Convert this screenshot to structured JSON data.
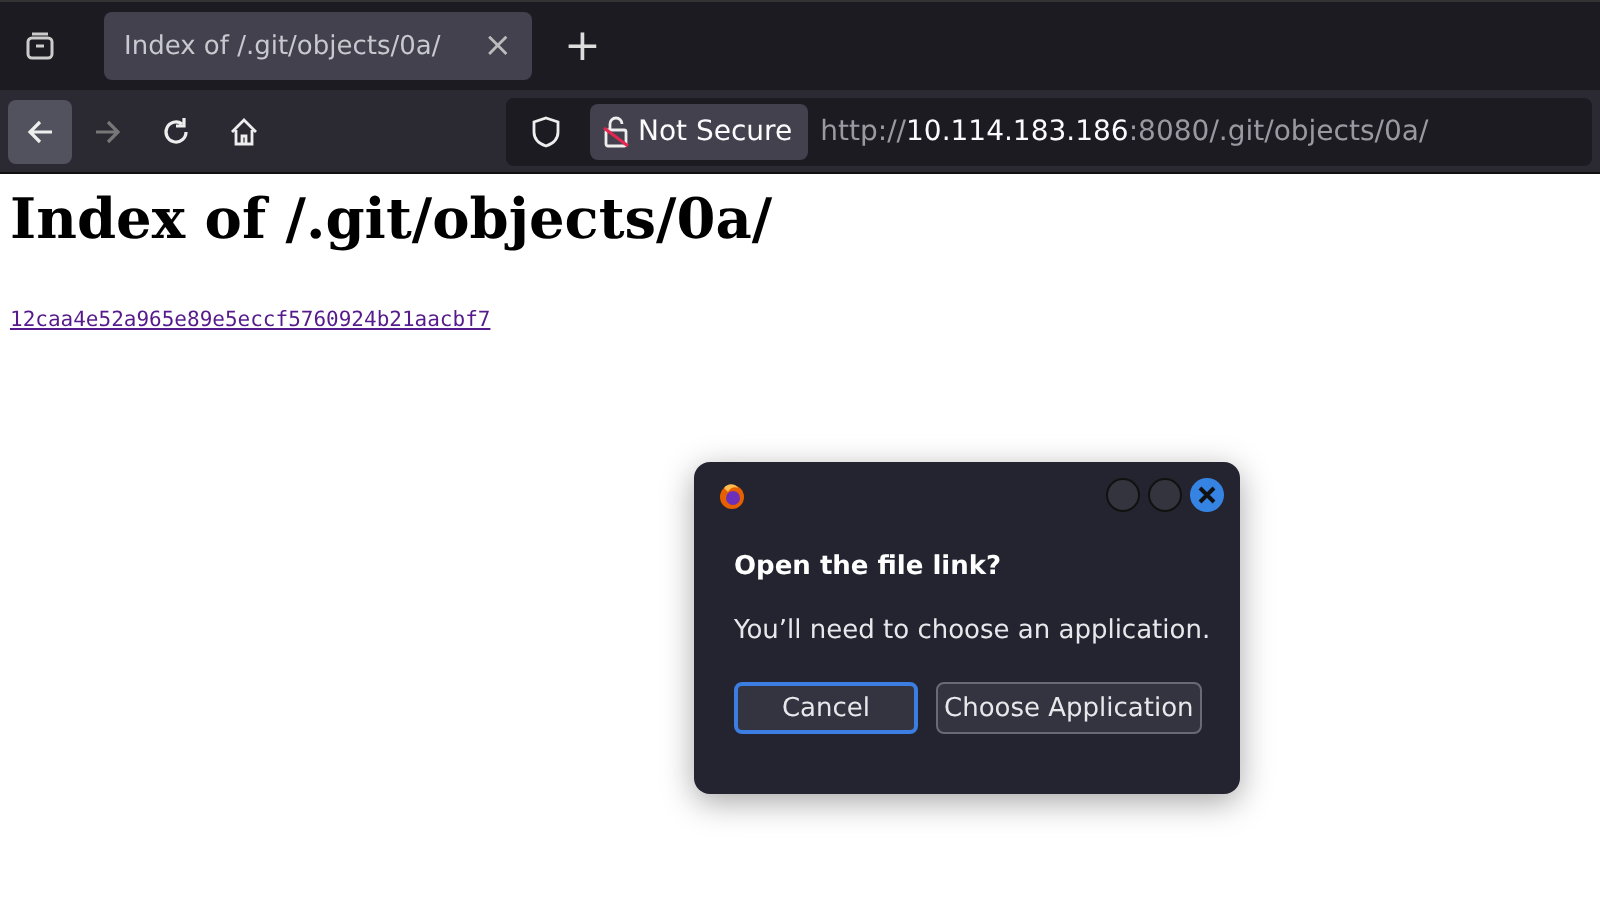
{
  "tabs": [
    {
      "title": "Index of /.git/objects/0a/",
      "close": "×",
      "selected": true
    }
  ],
  "new_tab": "+",
  "address_bar": {
    "security_label": "Not Secure",
    "url_parts": [
      {
        "text": "http://",
        "kind": "dim"
      },
      {
        "text": "10.114.183.186",
        "kind": "host"
      },
      {
        "text": ":8080/.git/objects/0a/",
        "kind": "dim"
      }
    ]
  },
  "page": {
    "heading": "Index of /.git/objects/0a/",
    "links": [
      "12caa4e52a965e89e5eccf5760924b21aacbf7"
    ]
  },
  "dialog": {
    "title": "Open the file link?",
    "message": "You’ll need to choose an application.",
    "buttons": [
      {
        "label": "Cancel",
        "focused": true
      },
      {
        "label": "Choose Application",
        "focused": false
      }
    ]
  }
}
